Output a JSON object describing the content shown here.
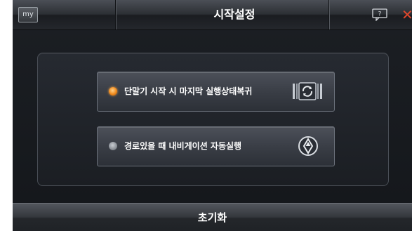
{
  "header": {
    "my_label": "my",
    "title": "시작설정",
    "help_icon": "help-question-icon",
    "close_icon": "close-icon",
    "close_color": "#e2472c"
  },
  "options": [
    {
      "label": "단말기 시작 시 마지막 실행상태복귀",
      "selected": true,
      "icon": "resume-refresh-icon"
    },
    {
      "label": "경로있을 때 내비게이션 자동실행",
      "selected": false,
      "icon": "navigation-compass-icon"
    }
  ],
  "footer": {
    "reset_label": "초기화"
  },
  "colors": {
    "accent_radio": "#f08a1c",
    "background": "#1c1f24"
  }
}
